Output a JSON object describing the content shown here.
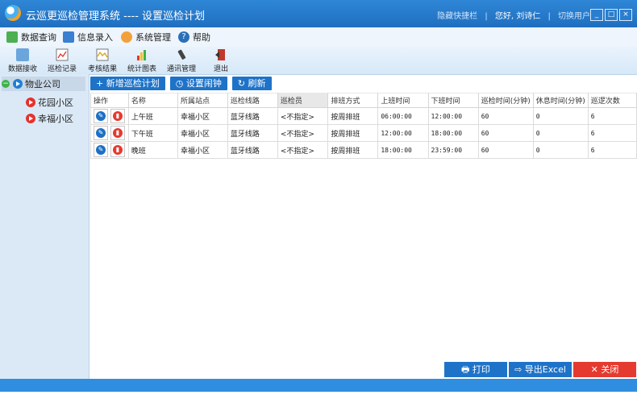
{
  "window": {
    "title": "云巡更巡检管理系统 ---- 设置巡检计划",
    "right_links": [
      "隐藏快捷栏",
      "您好, 刘诗仁",
      "切换用户"
    ],
    "controls": [
      "_",
      "□",
      "×"
    ]
  },
  "menu": [
    {
      "label": "数据查询",
      "icon": "data-query-icon"
    },
    {
      "label": "信息录入",
      "icon": "info-entry-icon"
    },
    {
      "label": "系统管理",
      "icon": "system-manage-icon"
    },
    {
      "label": "帮助",
      "icon": "help-icon"
    }
  ],
  "toolbar": [
    {
      "label": "数据接收",
      "icon": "data-receive-icon"
    },
    {
      "label": "巡检记录",
      "icon": "patrol-record-icon"
    },
    {
      "label": "考核结果",
      "icon": "assessment-icon"
    },
    {
      "label": "统计图表",
      "icon": "chart-icon"
    },
    {
      "label": "通讯管理",
      "icon": "comm-icon"
    },
    {
      "label": "退出",
      "icon": "exit-icon"
    }
  ],
  "tree": {
    "root": "物业公司",
    "children": [
      "花园小区",
      "幸福小区"
    ]
  },
  "actions": {
    "add": "+ 新增巡检计划",
    "alarm": "◷ 设置闹钟",
    "refresh": "↻ 刷新"
  },
  "table": {
    "headers": [
      "操作",
      "名称",
      "所属站点",
      "巡检线路",
      "巡检员",
      "排班方式",
      "上班时间",
      "下班时间",
      "巡检时间(分钟)",
      "休息时间(分钟)",
      "巡逻次数"
    ],
    "rows": [
      [
        "上午班",
        "幸福小区",
        "蓝牙线路",
        "<不指定>",
        "按周排班",
        "06:00:00",
        "12:00:00",
        "60",
        "0",
        "6"
      ],
      [
        "下午班",
        "幸福小区",
        "蓝牙线路",
        "<不指定>",
        "按周排班",
        "12:00:00",
        "18:00:00",
        "60",
        "0",
        "6"
      ],
      [
        "晚班",
        "幸福小区",
        "蓝牙线路",
        "<不指定>",
        "按周排班",
        "18:00:00",
        "23:59:00",
        "60",
        "0",
        "6"
      ]
    ]
  },
  "footer": {
    "print": "🖶 打印",
    "export": "⇨ 导出Excel",
    "close": "✕ 关闭"
  },
  "colors": {
    "titlebar": "#1f6fc0",
    "button_blue": "#1e73c9",
    "close_red": "#e53a2f"
  }
}
